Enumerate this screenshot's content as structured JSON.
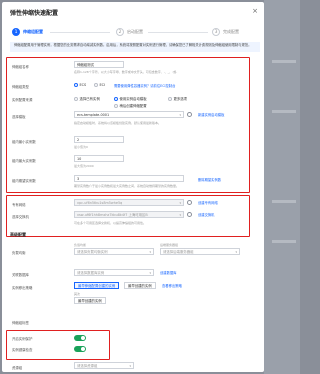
{
  "dialog": {
    "title": "弹性伸缩快速配置",
    "close": "×"
  },
  "steps": [
    {
      "num": "1",
      "label": "伸缩组配置"
    },
    {
      "num": "2",
      "label": "启动配置"
    },
    {
      "num": "3",
      "label": "完成配置"
    }
  ],
  "notice": "伸缩组配置用于管理实例，根据您的业务需求自动增减实例数。启用后，系统将按照配置对实例进行管理，请确保您已了解相关计费规则及伸缩组使用限制与规范。",
  "form": {
    "group_name": {
      "label": "伸缩组名称",
      "value": "伸缩组测试",
      "hint": "名称1-128个字符，以大小写字母、数字或中文开头，可包含数字、.、_、:或-"
    },
    "type": {
      "label": "伸缩组类型",
      "option_ecs": "ECS",
      "option_eci": "ECI",
      "link": "需要使用弹性容器实例？请前往ECI控制台"
    },
    "template": {
      "label": "实例配置来源",
      "opt1": "选择已有实例",
      "opt2": "使用实例启动模板",
      "opt3": "更多选项",
      "opt4": "稍后创建伸缩配置"
    },
    "template_select": {
      "label": "选择模板",
      "value": "ecs-template-0001",
      "link": "新建实例启动模板",
      "hint": "指定启动模板时，系统将以该模板创建实例，默认使用最新版本。"
    },
    "min": {
      "label": "组内最小实例数",
      "value": "2",
      "hint": "最小值为0"
    },
    "max": {
      "label": "组内最大实例数",
      "value": "10",
      "hint": "最大值为2000"
    },
    "expected": {
      "label": "组内期望实例数",
      "value": "3",
      "link": "删除期望实例数",
      "hint": "期望实例数介于最小实例数和最大实例数之间，系统自动维持期望的实例数量。"
    },
    "vpc": {
      "label": "专有网络",
      "value": "vpc-uf6n5tku1s8m5whe5q",
      "link": "创建专有网络"
    },
    "vswitch": {
      "label": "选择交换机",
      "value": "vsw-uf6f1hh8mxhz7kbu8k4f7 上海可用区B",
      "link": "创建交换机",
      "hint": "可在多个可用区选择交换机，以提高伸缩组的可用性。"
    },
    "advanced": {
      "label": "高级配置"
    },
    "lb": {
      "label": "负载均衡",
      "col1": "负载均衡",
      "col2": "后端服务器组",
      "sel1": "请选择负载均衡实例",
      "sel2": "请选择后端服务器组"
    },
    "db": {
      "label": "关联数据库",
      "sel": "请选择数据库实例",
      "link": "创建数据库"
    },
    "removal": {
      "label": "实例移出策略",
      "sel1": "最早伸缩配置创建的实例",
      "sel2": "最早创建的实例",
      "tag": "其次",
      "sel3": "最早伸缩配置创建的实例",
      "link": "查看移出策略"
    },
    "removal2": {
      "label": "移出策略2",
      "sel": "最早创建的实例"
    },
    "tags": {
      "label": "伸缩组标签"
    },
    "instance_protect": {
      "label": "开启实例保护"
    },
    "health_check": {
      "label": "实例健康检查"
    },
    "resource_group": {
      "label": "资源组",
      "sel": "请选择资源组"
    }
  },
  "colors": {
    "primary": "#1766ff",
    "highlight": "#e02020",
    "toggle_on": "#1aa25a"
  }
}
